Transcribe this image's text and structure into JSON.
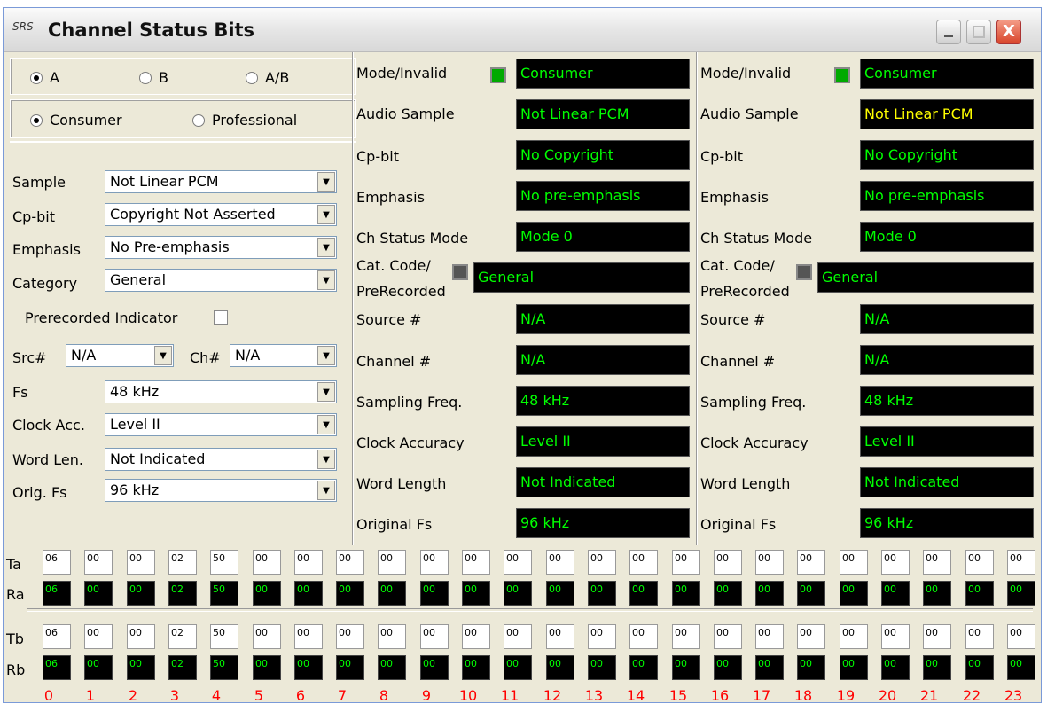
{
  "window": {
    "logo_text": "SRS",
    "title": "Channel Status Bits",
    "close_glyph": "X"
  },
  "left": {
    "channel_radios": [
      {
        "label": "A",
        "checked": true
      },
      {
        "label": "B",
        "checked": false
      },
      {
        "label": "A/B",
        "checked": false
      }
    ],
    "mode_radios": [
      {
        "label": "Consumer",
        "checked": true
      },
      {
        "label": "Professional",
        "checked": false
      }
    ],
    "sample_label": "Sample",
    "sample_value": "Not Linear PCM",
    "cpbit_label": "Cp-bit",
    "cpbit_value": "Copyright Not Asserted",
    "emphasis_label": "Emphasis",
    "emphasis_value": "No Pre-emphasis",
    "category_label": "Category",
    "category_value": "General",
    "prerecorded_label": "Prerecorded Indicator",
    "prerecorded_checked": false,
    "src_label": "Src#",
    "src_value": "N/A",
    "ch_label": "Ch#",
    "ch_value": "N/A",
    "fs_label": "Fs",
    "fs_value": "48 kHz",
    "clock_label": "Clock Acc.",
    "clock_value": "Level II",
    "wordlen_label": "Word Len.",
    "wordlen_value": "Not Indicated",
    "origfs_label": "Orig. Fs",
    "origfs_value": "96 kHz"
  },
  "status_labels": {
    "mode": "Mode/Invalid",
    "audio": "Audio Sample",
    "cpbit": "Cp-bit",
    "emphasis": "Emphasis",
    "chmode": "Ch Status Mode",
    "catcode_1": "Cat. Code/",
    "catcode_2": "PreRecorded",
    "source": "Source #",
    "channel": "Channel #",
    "sampling": "Sampling Freq.",
    "clock": "Clock Accuracy",
    "wordlen": "Word Length",
    "origfs": "Original Fs"
  },
  "status_a": {
    "mode": "Consumer",
    "audio": "Not Linear PCM",
    "cpbit": "No Copyright",
    "emphasis": "No pre-emphasis",
    "chmode": "Mode 0",
    "catcode": "General",
    "source": "N/A",
    "channel": "N/A",
    "sampling": "48 kHz",
    "clock": "Level II",
    "wordlen": "Not Indicated",
    "origfs": "96 kHz"
  },
  "status_b": {
    "mode": "Consumer",
    "audio": "Not Linear PCM",
    "cpbit": "No Copyright",
    "emphasis": "No pre-emphasis",
    "chmode": "Mode 0",
    "catcode": "General",
    "source": "N/A",
    "channel": "N/A",
    "sampling": "48 kHz",
    "clock": "Level II",
    "wordlen": "Not Indicated",
    "origfs": "96 kHz"
  },
  "colors": {
    "green_text": "#00ff00",
    "yellow_text": "#ffff00",
    "index_red": "#ff0000"
  },
  "bits": {
    "row_labels": [
      "Ta",
      "Ra",
      "Tb",
      "Rb"
    ],
    "Ta": [
      "06",
      "00",
      "00",
      "02",
      "50",
      "00",
      "00",
      "00",
      "00",
      "00",
      "00",
      "00",
      "00",
      "00",
      "00",
      "00",
      "00",
      "00",
      "00",
      "00",
      "00",
      "00",
      "00",
      "00"
    ],
    "Ra": [
      "06",
      "00",
      "00",
      "02",
      "50",
      "00",
      "00",
      "00",
      "00",
      "00",
      "00",
      "00",
      "00",
      "00",
      "00",
      "00",
      "00",
      "00",
      "00",
      "00",
      "00",
      "00",
      "00",
      "00"
    ],
    "Tb": [
      "06",
      "00",
      "00",
      "02",
      "50",
      "00",
      "00",
      "00",
      "00",
      "00",
      "00",
      "00",
      "00",
      "00",
      "00",
      "00",
      "00",
      "00",
      "00",
      "00",
      "00",
      "00",
      "00",
      "00"
    ],
    "Rb": [
      "06",
      "00",
      "00",
      "02",
      "50",
      "00",
      "00",
      "00",
      "00",
      "00",
      "00",
      "00",
      "00",
      "00",
      "00",
      "00",
      "00",
      "00",
      "00",
      "00",
      "00",
      "00",
      "00",
      "00"
    ],
    "indices": [
      "0",
      "1",
      "2",
      "3",
      "4",
      "5",
      "6",
      "7",
      "8",
      "9",
      "10",
      "11",
      "12",
      "13",
      "14",
      "15",
      "16",
      "17",
      "18",
      "19",
      "20",
      "21",
      "22",
      "23"
    ]
  }
}
